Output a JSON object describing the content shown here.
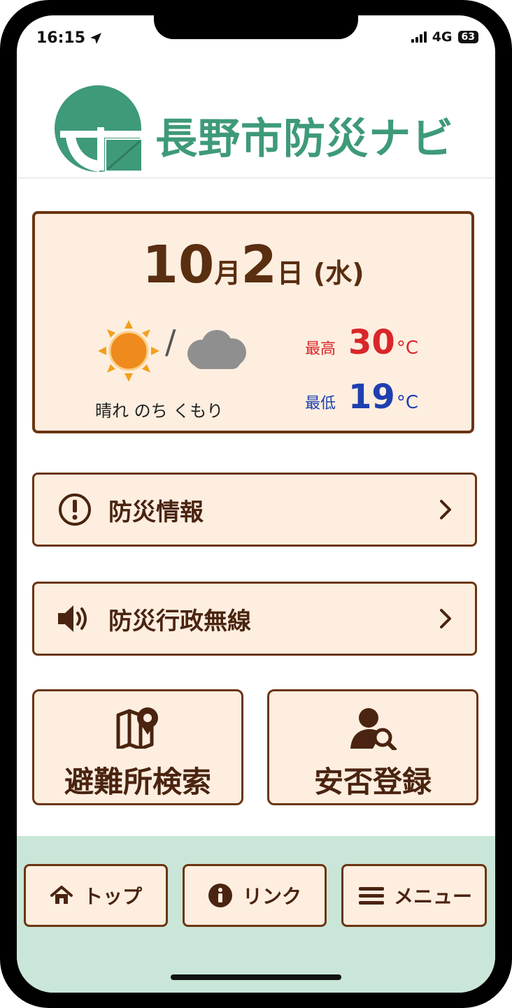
{
  "status": {
    "time": "16:15",
    "network": "4G",
    "battery": "63"
  },
  "app": {
    "title": "長野市防災ナビ"
  },
  "weather": {
    "date_month": "10",
    "month_unit": "月",
    "date_day": "2",
    "day_unit": "日",
    "weekday": "(水)",
    "description": "晴れ のち くもり",
    "icons": [
      "sun-icon",
      "cloud-icon"
    ],
    "high_label": "最高",
    "high_value": "30",
    "low_label": "最低",
    "low_value": "19",
    "unit": "°C",
    "colors": {
      "high": "#d9262a",
      "low": "#1f3fb0"
    }
  },
  "menu": {
    "disaster_info": "防災情報",
    "radio": "防災行政無線",
    "shelter_search": "避難所検索",
    "safety_register": "安否登録"
  },
  "tabs": {
    "top": "トップ",
    "link": "リンク",
    "menu": "メニュー"
  },
  "colors": {
    "brand_green": "#3e9a78",
    "button_bg": "#fdeee0",
    "button_border": "#6b3512",
    "bottom_bar": "#c9e6d8"
  }
}
